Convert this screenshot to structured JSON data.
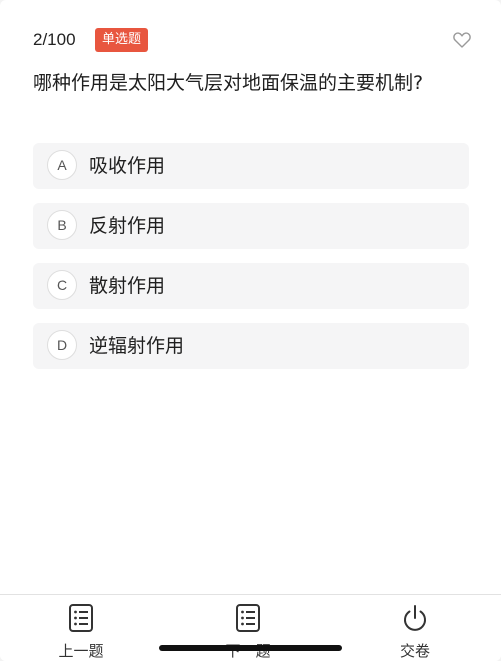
{
  "header": {
    "progress": "2/100",
    "question_type": "单选题",
    "favorite_icon": "heart-outline-icon"
  },
  "question": {
    "text": "哪种作用是太阳大气层对地面保温的主要机制?"
  },
  "options": [
    {
      "key": "A",
      "text": "吸收作用"
    },
    {
      "key": "B",
      "text": "反射作用"
    },
    {
      "key": "C",
      "text": "散射作用"
    },
    {
      "key": "D",
      "text": "逆辐射作用"
    }
  ],
  "bottom_bar": {
    "prev_label": "上一题",
    "next_label": "下一题",
    "submit_label": "交卷",
    "prev_icon": "list-icon",
    "next_icon": "list-icon",
    "submit_icon": "power-icon"
  },
  "colors": {
    "badge": "#e8563f",
    "text": "#1f1f1f",
    "option_bg": "#f5f5f6"
  }
}
